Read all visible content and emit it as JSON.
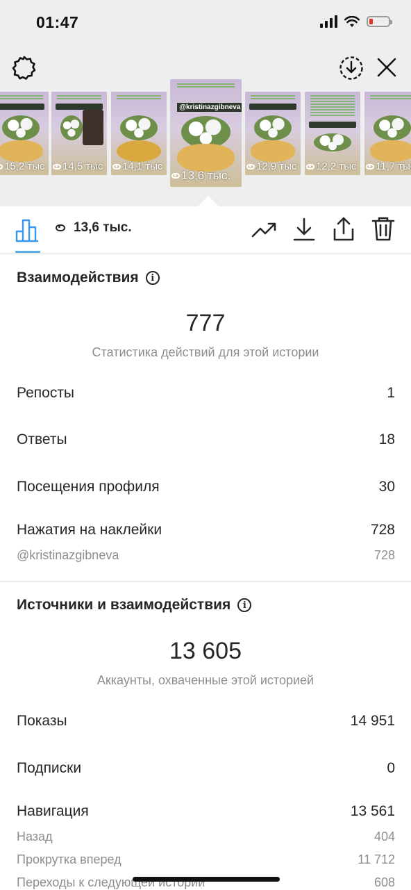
{
  "status_bar": {
    "time": "01:47"
  },
  "story_strip": [
    {
      "views": "15,2 тыс",
      "style": "flowers-pastry",
      "handle": "@kristinazgibneva"
    },
    {
      "views": "14,5 тыс",
      "style": "flowers-portrait",
      "handle": "@kristinazgibneva"
    },
    {
      "views": "14,1 тыс",
      "style": "flowers-pie",
      "handle": ""
    },
    {
      "views": "13,6 тыс.",
      "style": "flowers-pastry",
      "handle": "@kristinazgibneva",
      "active": true
    },
    {
      "views": "12,9 тыс",
      "style": "flowers-pastry",
      "handle": "@kristinazgibneva"
    },
    {
      "views": "12,2 тыс",
      "style": "flowers",
      "handle": "@kristinazgibneva"
    },
    {
      "views": "11,7 тыс",
      "style": "flowers-pastry",
      "handle": ""
    }
  ],
  "toolbar": {
    "views": "13,6 тыс."
  },
  "interactions": {
    "title": "Взаимодействия",
    "total": "777",
    "caption": "Статистика действий для этой истории",
    "rows": [
      {
        "label": "Репосты",
        "value": "1"
      },
      {
        "label": "Ответы",
        "value": "18"
      },
      {
        "label": "Посещения профиля",
        "value": "30"
      },
      {
        "label": "Нажатия на наклейки",
        "value": "728"
      }
    ],
    "sticker_sub": {
      "label": "@kristinazgibneva",
      "value": "728"
    }
  },
  "sources": {
    "title": "Источники и взаимодействия",
    "total": "13 605",
    "caption": "Аккаунты, охваченные этой историей",
    "rows": [
      {
        "label": "Показы",
        "value": "14 951"
      },
      {
        "label": "Подписки",
        "value": "0"
      },
      {
        "label": "Навигация",
        "value": "13 561"
      }
    ],
    "nav_sub": [
      {
        "label": "Назад",
        "value": "404"
      },
      {
        "label": "Прокрутка вперед",
        "value": "11 712"
      },
      {
        "label": "Переходы к следующей истории",
        "value": "608"
      }
    ]
  },
  "colors": {
    "accent_underline": "#5ab0e8",
    "battery_low": "#e0332e",
    "secondary_text": "#8e8e8e"
  }
}
